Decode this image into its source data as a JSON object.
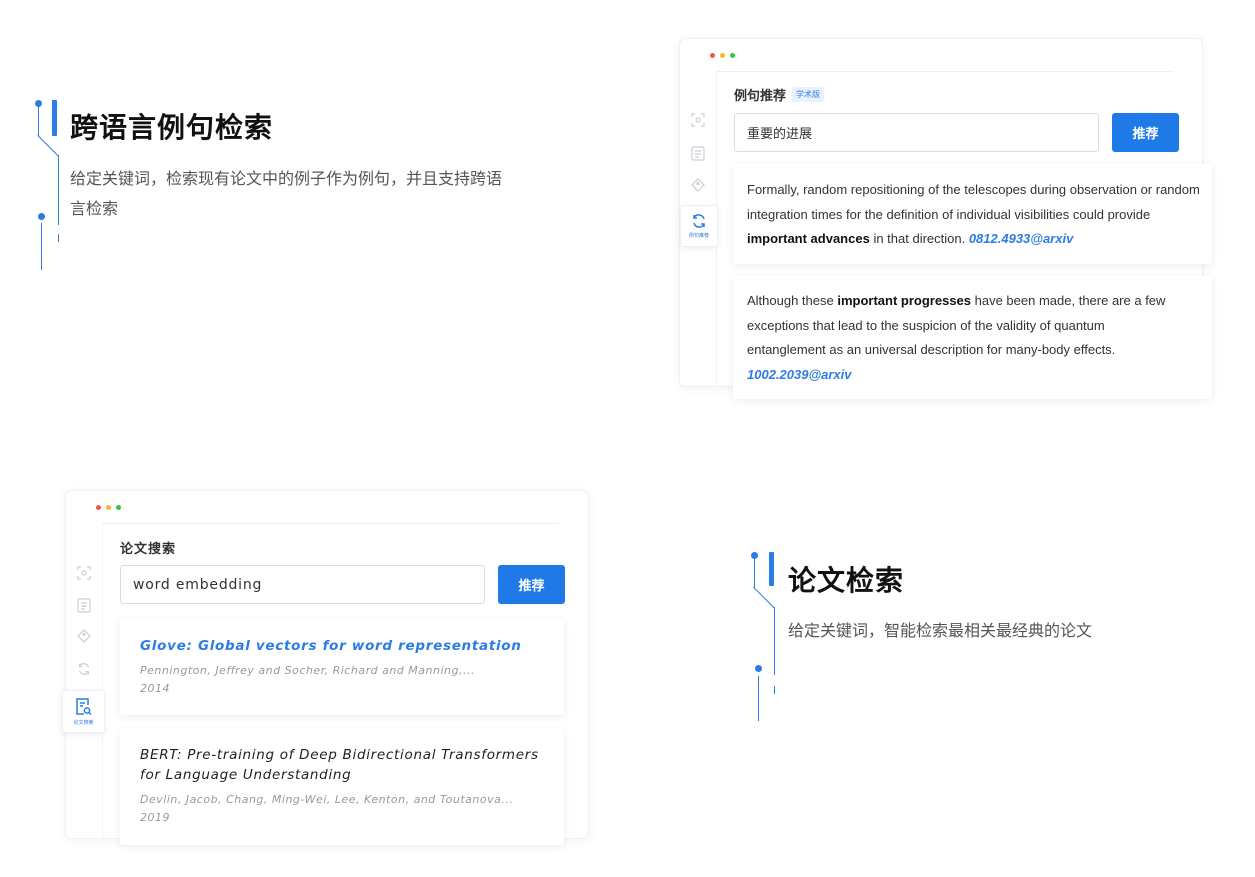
{
  "feature1": {
    "title": "跨语言例句检索",
    "description": "给定关键词，检索现有论文中的例子作为例句，并且支持跨语言检索"
  },
  "feature2": {
    "title": "论文检索",
    "description": "给定关键词，智能检索最相关最经典的论文"
  },
  "window1": {
    "sidebar_active_label": "例句推荐",
    "panel_title": "例句推荐",
    "badge": "学术版",
    "search_value": "重要的进展",
    "button_label": "推荐",
    "results": [
      {
        "before": "Formally, random repositioning of the telescopes during observation or random integration times for the definition of individual visibilities could provide ",
        "highlight": "important advances",
        "after": " in that direction. ",
        "source": "0812.4933@arxiv"
      },
      {
        "before": "Although these ",
        "highlight": "important progresses",
        "after": " have been made, there are a few exceptions that lead to the suspicion of the validity of quantum entanglement as an universal description for many-body effects. ",
        "source": "1002.2039@arxiv"
      }
    ]
  },
  "window2": {
    "sidebar_active_label": "论文搜索",
    "panel_title": "论文搜索",
    "search_value": "word embedding",
    "button_label": "推荐",
    "results": [
      {
        "title": "Glove: Global vectors for word representation",
        "authors": "Pennington, Jeffrey and Socher, Richard and Manning,...",
        "year": "2014"
      },
      {
        "title": "BERT: Pre-training of Deep Bidirectional Transformers for Language Understanding",
        "authors": "Devlin, Jacob, Chang, Ming-Wei, Lee, Kenton, and Toutanova...",
        "year": "2019"
      }
    ]
  },
  "colors": {
    "accent": "#2d7be5",
    "button": "#1f7ae8",
    "traffic_red": "#f0544c",
    "traffic_yellow": "#f5b72d",
    "traffic_green": "#2fc740"
  },
  "icons": [
    "scan-icon",
    "document-icon",
    "tag-icon",
    "refresh-icon",
    "doc-search-icon"
  ]
}
